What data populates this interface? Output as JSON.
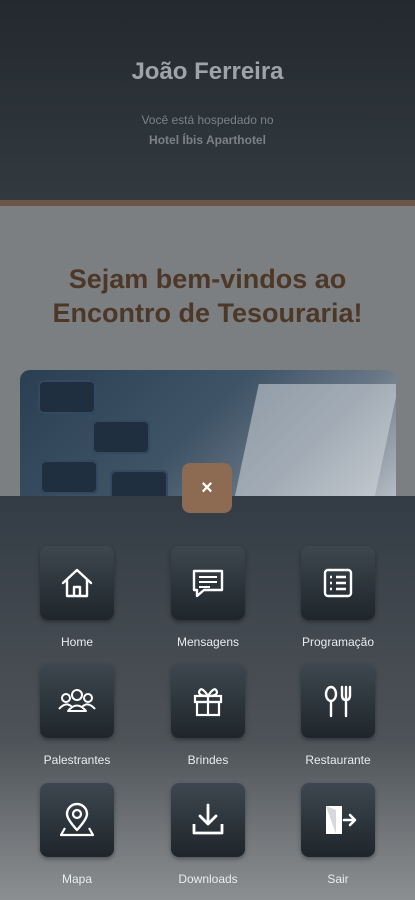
{
  "header": {
    "guest_name": "João Ferreira",
    "stay_prefix": "Você está hospedado no",
    "hotel_name": "Hotel Íbis Aparthotel"
  },
  "welcome": {
    "line1": "Sejam bem-vindos ao",
    "line2": "Encontro de Tesouraria!"
  },
  "menu": {
    "close_symbol": "×",
    "items": [
      {
        "label": "Home",
        "icon": "home-icon"
      },
      {
        "label": "Mensagens",
        "icon": "message-icon"
      },
      {
        "label": "Programação",
        "icon": "schedule-icon"
      },
      {
        "label": "Palestrantes",
        "icon": "people-icon"
      },
      {
        "label": "Brindes",
        "icon": "gift-icon"
      },
      {
        "label": "Restaurante",
        "icon": "restaurant-icon"
      },
      {
        "label": "Mapa",
        "icon": "map-pin-icon"
      },
      {
        "label": "Downloads",
        "icon": "download-icon"
      },
      {
        "label": "Sair",
        "icon": "exit-icon"
      }
    ]
  },
  "colors": {
    "accent": "#8d6b52",
    "welcome_text": "#4d3727",
    "header_bg": "#23292e"
  }
}
